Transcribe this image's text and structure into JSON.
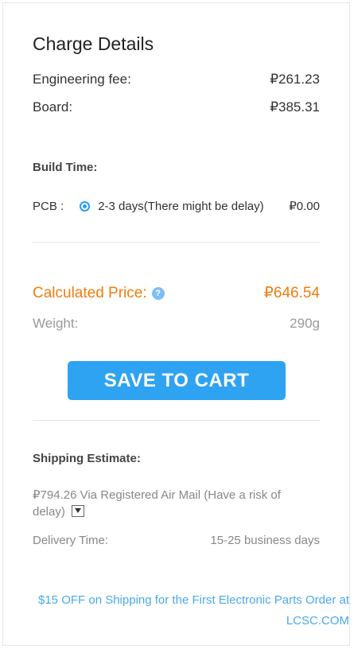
{
  "charge_details": {
    "title": "Charge Details",
    "engineering_fee": {
      "label": "Engineering fee:",
      "value": "₽261.23"
    },
    "board": {
      "label": "Board:",
      "value": "₽385.31"
    }
  },
  "build_time": {
    "label": "Build Time:",
    "pcb_label": "PCB :",
    "option": "2-3 days(There might be delay)",
    "option_selected": true,
    "option_price": "₽0.00"
  },
  "calculated_price": {
    "label": "Calculated Price:",
    "value": "₽646.54",
    "help_icon": "question-circle-icon"
  },
  "weight": {
    "label": "Weight:",
    "value": "290g"
  },
  "save_to_cart_label": "SAVE TO CART",
  "shipping": {
    "label": "Shipping Estimate:",
    "price": "₽794.26",
    "via": "Via",
    "method": "Registered Air Mail (Have a risk of delay)",
    "delivery_label": "Delivery Time:",
    "delivery_value": "15-25 business days"
  },
  "promo": "$15 OFF on Shipping for the First Electronic Parts Order at LCSC.COM",
  "colors": {
    "accent": "#2ea3f2",
    "price": "#f07c0c",
    "link": "#4aa9f0"
  }
}
